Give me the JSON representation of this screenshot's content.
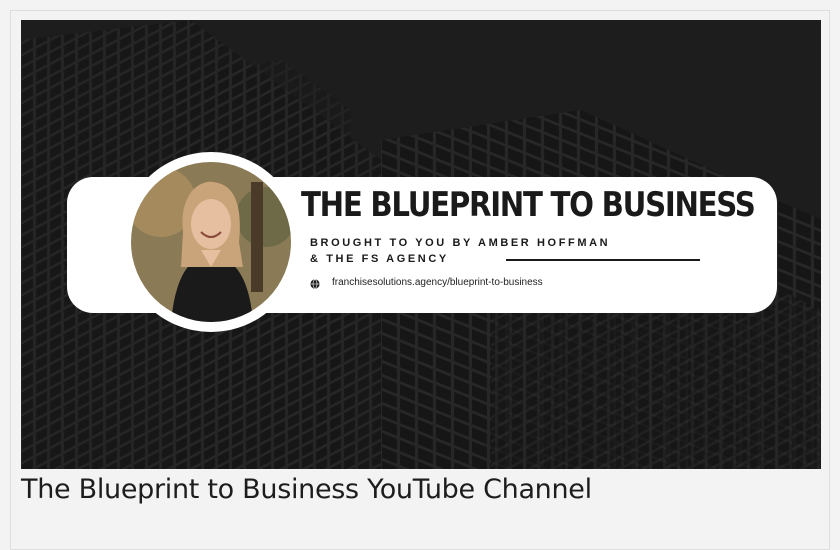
{
  "banner": {
    "title": "THE BLUEPRINT TO BUSINESS",
    "subtitle_line1": "BROUGHT TO YOU BY AMBER HOFFMAN",
    "subtitle_line2": "& THE FS AGENCY",
    "url": "franchisesolutions.agency/blueprint-to-business",
    "url_icon": "globe-icon"
  },
  "caption": "The Blueprint to Business YouTube Channel",
  "colors": {
    "banner_background": "#1c1c1c",
    "pill": "#ffffff",
    "text": "#1a1a1a"
  }
}
